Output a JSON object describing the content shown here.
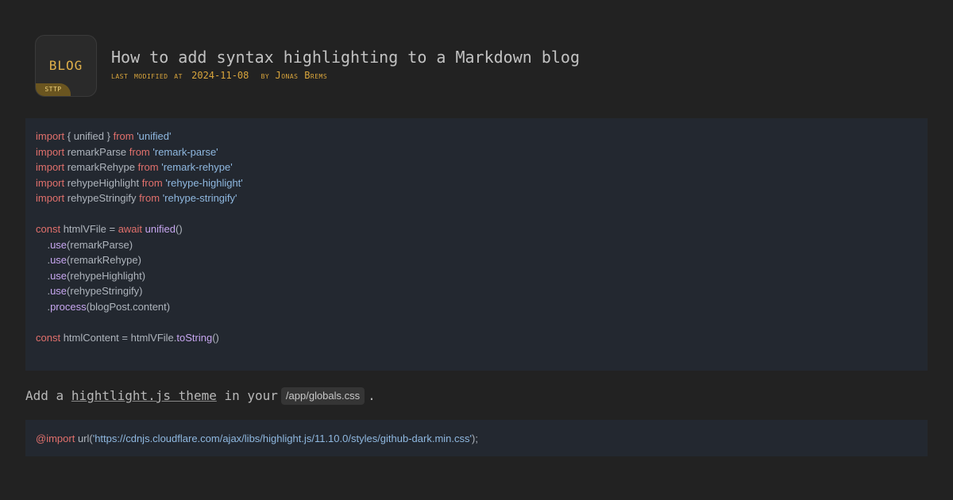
{
  "logo": {
    "text": "BLOG",
    "badge": "STTP"
  },
  "post": {
    "title": "How to add syntax highlighting to a Markdown blog",
    "meta_prefix": "last modified at",
    "date": "2024-11-08",
    "meta_by": "by",
    "author": "Jonas Brems"
  },
  "code_block_1": {
    "lines": [
      [
        [
          "kw",
          "import"
        ],
        [
          "plain",
          " { unified } "
        ],
        [
          "kw",
          "from"
        ],
        [
          "plain",
          " "
        ],
        [
          "str",
          "'unified'"
        ]
      ],
      [
        [
          "kw",
          "import"
        ],
        [
          "plain",
          " remarkParse "
        ],
        [
          "kw",
          "from"
        ],
        [
          "plain",
          " "
        ],
        [
          "str",
          "'remark-parse'"
        ]
      ],
      [
        [
          "kw",
          "import"
        ],
        [
          "plain",
          " remarkRehype "
        ],
        [
          "kw",
          "from"
        ],
        [
          "plain",
          " "
        ],
        [
          "str",
          "'remark-rehype'"
        ]
      ],
      [
        [
          "kw",
          "import"
        ],
        [
          "plain",
          " rehypeHighlight "
        ],
        [
          "kw",
          "from"
        ],
        [
          "plain",
          " "
        ],
        [
          "str",
          "'rehype-highlight'"
        ]
      ],
      [
        [
          "kw",
          "import"
        ],
        [
          "plain",
          " rehypeStringify "
        ],
        [
          "kw",
          "from"
        ],
        [
          "plain",
          " "
        ],
        [
          "str",
          "'rehype-stringify'"
        ]
      ],
      [],
      [
        [
          "kw",
          "const"
        ],
        [
          "plain",
          " htmlVFile = "
        ],
        [
          "kw",
          "await"
        ],
        [
          "plain",
          " "
        ],
        [
          "fn",
          "unified"
        ],
        [
          "plain",
          "()"
        ]
      ],
      [
        [
          "plain",
          "    ."
        ],
        [
          "fn",
          "use"
        ],
        [
          "plain",
          "(remarkParse)"
        ]
      ],
      [
        [
          "plain",
          "    ."
        ],
        [
          "fn",
          "use"
        ],
        [
          "plain",
          "(remarkRehype)"
        ]
      ],
      [
        [
          "plain",
          "    ."
        ],
        [
          "fn",
          "use"
        ],
        [
          "plain",
          "(rehypeHighlight)"
        ]
      ],
      [
        [
          "plain",
          "    ."
        ],
        [
          "fn",
          "use"
        ],
        [
          "plain",
          "(rehypeStringify)"
        ]
      ],
      [
        [
          "plain",
          "    ."
        ],
        [
          "fn",
          "process"
        ],
        [
          "plain",
          "(blogPost.content)"
        ]
      ],
      [],
      [
        [
          "kw",
          "const"
        ],
        [
          "plain",
          " htmlContent = htmlVFile."
        ],
        [
          "fn",
          "toString"
        ],
        [
          "plain",
          "()"
        ]
      ]
    ]
  },
  "paragraph": {
    "before": "Add a",
    "link": "hightlight.js theme",
    "middle": "in your",
    "code": "/app/globals.css",
    "after": "."
  },
  "code_block_2": {
    "lines": [
      [
        [
          "kw",
          "@import"
        ],
        [
          "plain",
          " url("
        ],
        [
          "str",
          "'https://cdnjs.cloudflare.com/ajax/libs/highlight.js/11.10.0/styles/github-dark.min.css'"
        ],
        [
          "plain",
          ");"
        ]
      ]
    ]
  },
  "colors": {
    "background": "#222222",
    "code_background": "#232830",
    "keyword": "#e1706c",
    "string": "#8fb8e0",
    "function": "#c7a6f0",
    "accent": "#d9a53c"
  }
}
